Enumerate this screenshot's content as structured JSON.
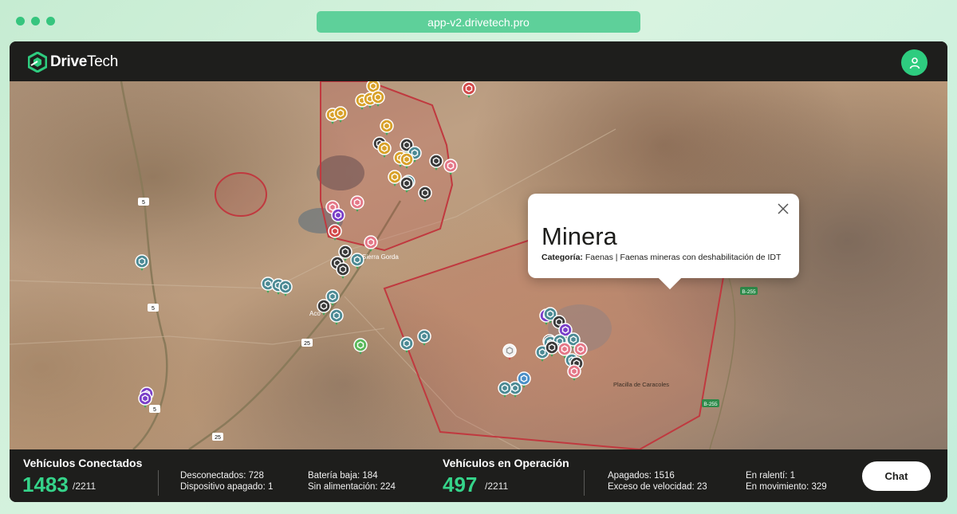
{
  "browser": {
    "url": "app-v2.drivetech.pro"
  },
  "app": {
    "logo_bold": "Drive",
    "logo_light": "Tech",
    "accent": "#2ecc7f"
  },
  "map": {
    "labels": {
      "town1": "Sierra Gorda",
      "town2": "Aco",
      "placilla": "Placilla de Caracoles"
    },
    "roads": [
      "5",
      "5",
      "5",
      "25",
      "25",
      "B-255",
      "B-255"
    ],
    "geofence_color": "#c0393f"
  },
  "popup": {
    "title": "Minera",
    "category_label": "Categoría:",
    "category_value": "Faenas | Faenas mineras con deshabilitación de IDT"
  },
  "stats": {
    "connected": {
      "title": "Vehículos Conectados",
      "value": "1483",
      "total": "/2211",
      "disconnected": "Desconectados: 728",
      "device_off": "Dispositivo apagado: 1",
      "low_battery": "Batería baja: 184",
      "no_power": "Sin alimentación: 224"
    },
    "operation": {
      "title": "Vehículos en Operación",
      "value": "497",
      "total": "/2211",
      "off": "Apagados: 1516",
      "speeding": "Exceso de velocidad: 23",
      "idle": "En ralentí: 1",
      "moving": "En movimiento: 329"
    }
  },
  "chat": {
    "label": "Chat"
  }
}
